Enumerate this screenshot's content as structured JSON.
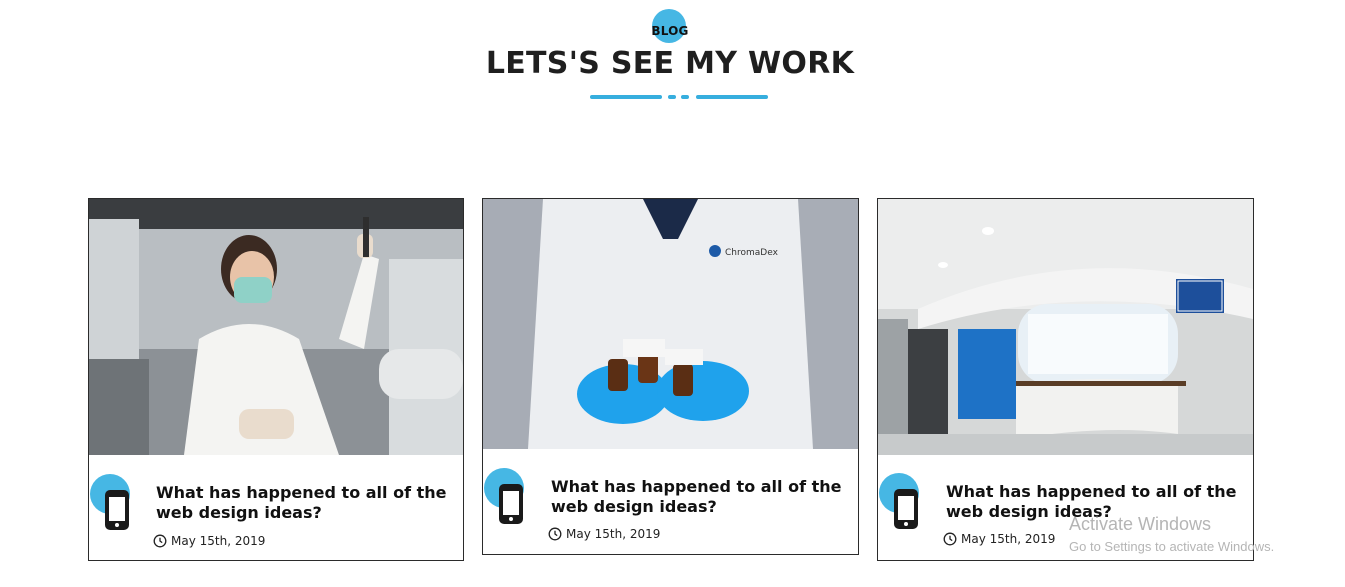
{
  "header": {
    "badge": "BLOG",
    "title": "LETS'S SEE MY WORK",
    "accent_color": "#36aede"
  },
  "cards": [
    {
      "title": "What has happened to all of the web design ideas?",
      "date": "May 15th, 2019",
      "icon": "smartphone-icon",
      "image": "scientist in lab holding vial"
    },
    {
      "title": "What has happened to all of the web design ideas?",
      "date": "May 15th, 2019",
      "icon": "smartphone-icon",
      "image": "gloved hands holding medicine bottles"
    },
    {
      "title": "What has happened to all of the web design ideas?",
      "date": "May 15th, 2019",
      "icon": "smartphone-icon",
      "image": "hospital reception desk"
    }
  ],
  "watermark": {
    "line1": "Activate Windows",
    "line2": "Go to Settings to activate Windows."
  }
}
